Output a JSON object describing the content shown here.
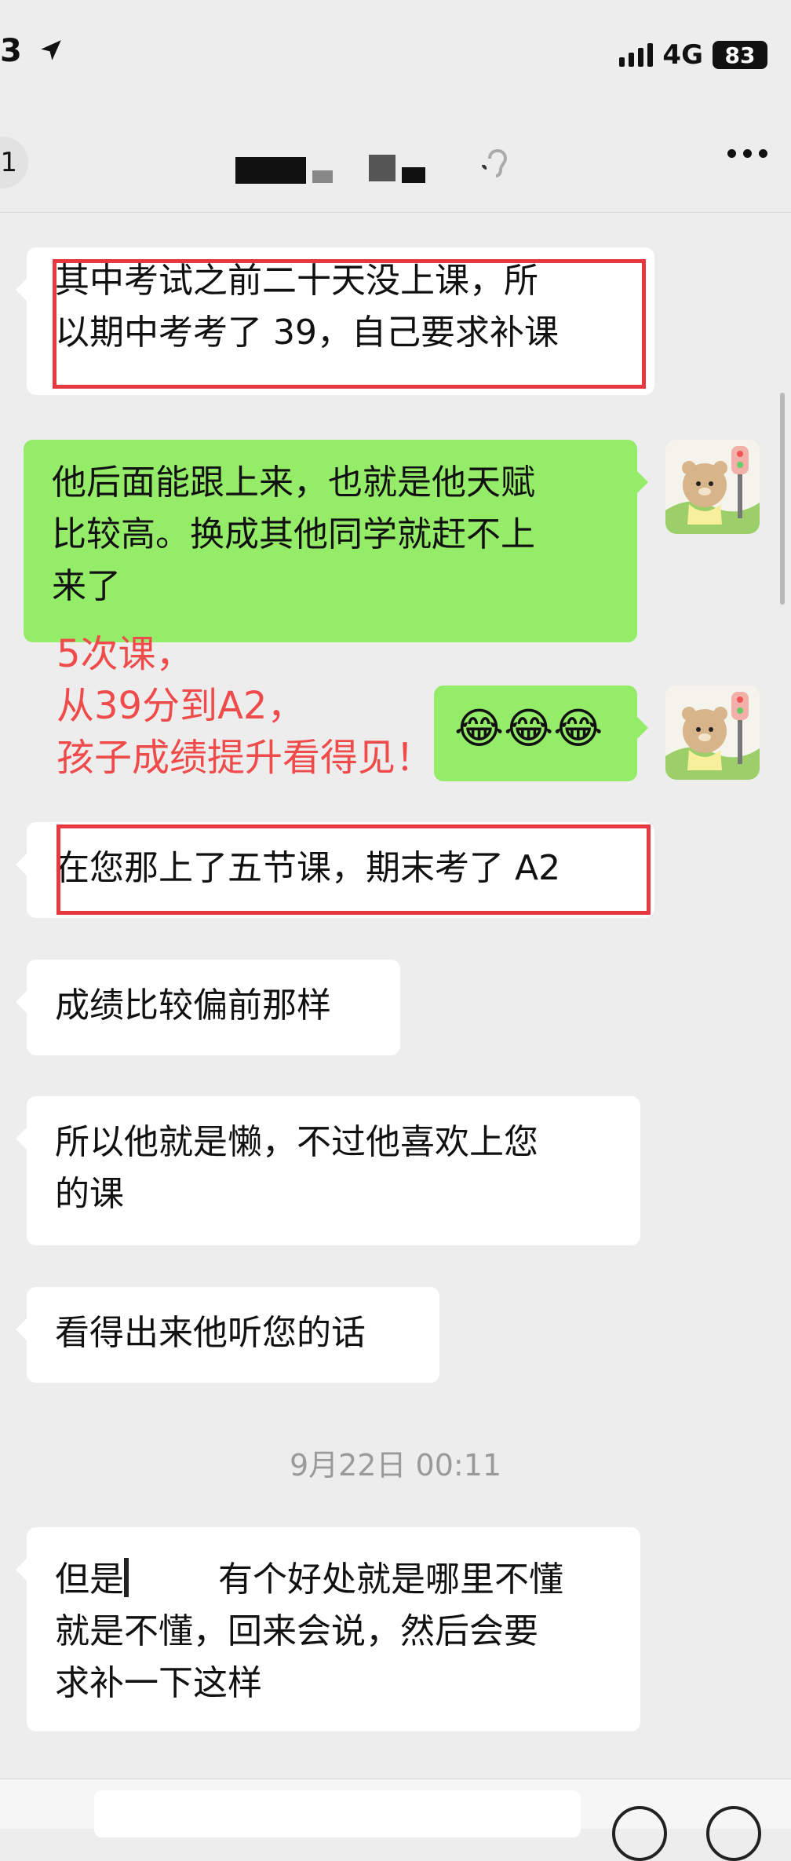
{
  "status_bar": {
    "time": "3",
    "network": "4G",
    "battery": "83"
  },
  "header": {
    "back_count": "1",
    "ear_icon": "ear-icon",
    "more_icon": "more-icon"
  },
  "messages": [
    {
      "side": "in",
      "text_lines": [
        "其中考试之前二十天没上课，所",
        "以期中考考了 39，自己要求补课"
      ],
      "highlighted": true
    },
    {
      "side": "out",
      "text_lines": [
        "他后面能跟上来，也就是他天赋",
        "比较高。换成其他同学就赶不上",
        "来了"
      ]
    },
    {
      "side": "out",
      "text": "😂😂😂"
    },
    {
      "side": "in",
      "text": "在您那上了五节课，期末考了 A2",
      "highlighted": true
    },
    {
      "side": "in",
      "text": "成绩比较偏前那样"
    },
    {
      "side": "in",
      "text_lines": [
        "所以他就是懒，不过他喜欢上您",
        "的课"
      ]
    },
    {
      "side": "in",
      "text": "看得出来他听您的话"
    },
    {
      "side": "in",
      "text_lines": [
        "但是",
        "有个好处就是哪里不懂",
        "就是不懂，回来会说，然后会要",
        "求补一下这样"
      ]
    }
  ],
  "annotation": {
    "lines": [
      "5次课，",
      "从39分到A2，",
      "孩子成绩提升看得见！"
    ],
    "color": "#ef4b4b"
  },
  "timestamp": "9月22日 00:11",
  "colors": {
    "background": "#ededed",
    "outgoing_bubble": "#95ec69",
    "incoming_bubble": "#ffffff",
    "highlight": "#e8383f"
  }
}
